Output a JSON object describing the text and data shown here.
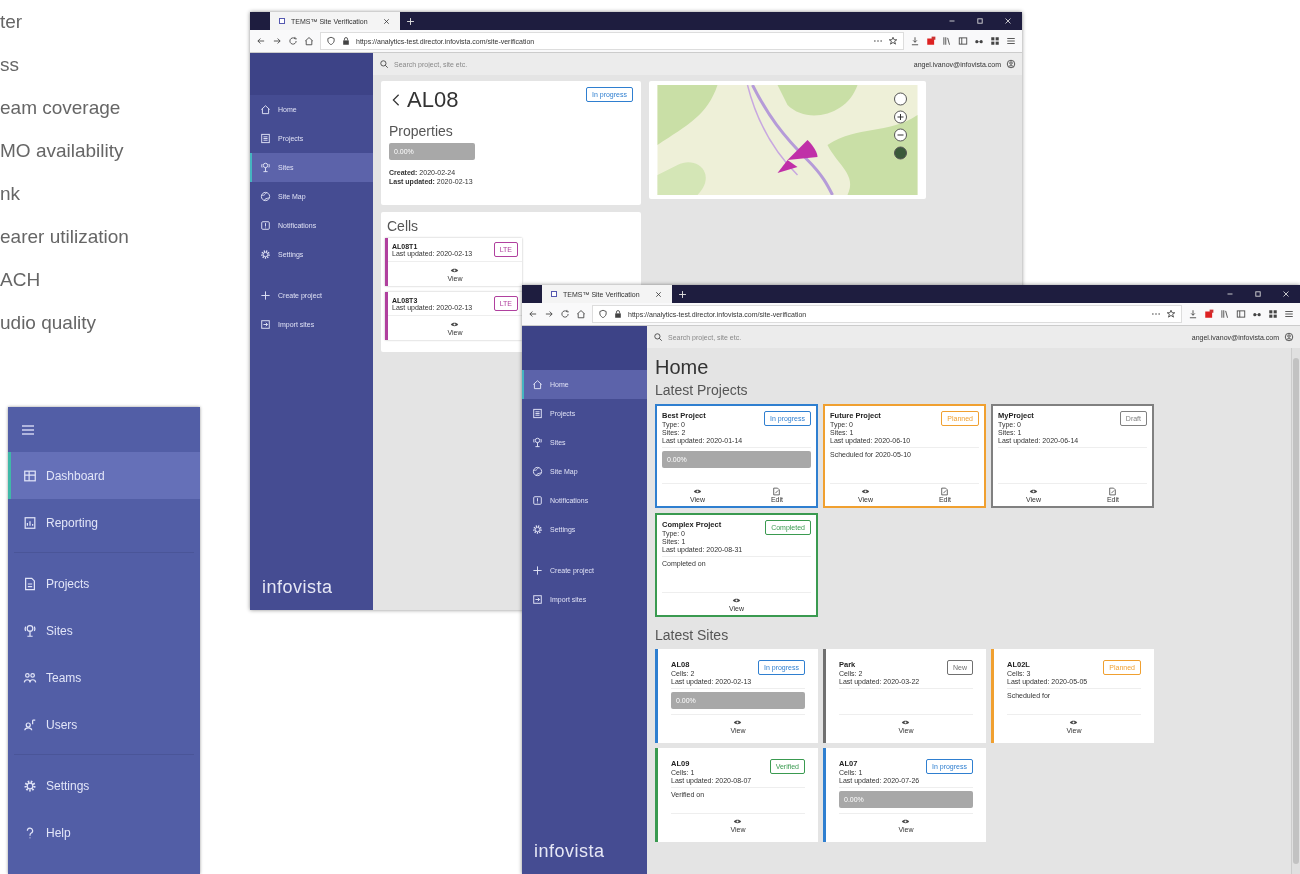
{
  "feature_list": [
    "ter",
    "ss",
    "eam coverage",
    "MO availability",
    "nk",
    "earer utilization",
    "ACH",
    "udio quality"
  ],
  "side_panel": {
    "groups": [
      [
        {
          "label": "Dashboard",
          "selected": true
        },
        {
          "label": "Reporting",
          "selected": false
        }
      ],
      [
        {
          "label": "Projects",
          "selected": false
        },
        {
          "label": "Sites",
          "selected": false
        },
        {
          "label": "Teams",
          "selected": false
        },
        {
          "label": "Users",
          "selected": false
        }
      ],
      [
        {
          "label": "Settings",
          "selected": false
        },
        {
          "label": "Help",
          "selected": false
        }
      ]
    ]
  },
  "back_window": {
    "tab_title": "TEMS™ Site Verification",
    "url": "https://analytics-test.director.infovista.com/site-verification",
    "search_placeholder": "Search project, site etc.",
    "user_email": "angel.ivanov@infovista.com",
    "nav": [
      {
        "label": "Home",
        "selected": false
      },
      {
        "label": "Projects",
        "selected": false
      },
      {
        "label": "Sites",
        "selected": true
      },
      {
        "label": "Site Map",
        "selected": false
      },
      {
        "label": "Notifications",
        "selected": false
      },
      {
        "label": "Settings",
        "selected": false
      }
    ],
    "actions": [
      "Create project",
      "Import sites"
    ],
    "logo": "infovista",
    "site": {
      "title": "AL08",
      "status": "In progress",
      "color": "#2f7fd0",
      "properties_heading": "Properties",
      "progress": {
        "level": 0,
        "label": "0.00%"
      },
      "dates": [
        "**Created:** 2020-02-24",
        "**Last updated:** 2020-02-13"
      ]
    },
    "cells": {
      "heading": "Cells",
      "items": [
        {
          "name": "AL08T1",
          "updated": "Last updated: 2020-02-13",
          "tech": "LTE",
          "color": "#b0409e",
          "action": "View"
        },
        {
          "name": "AL08T3",
          "updated": "Last updated: 2020-02-13",
          "tech": "LTE",
          "color": "#b0409e",
          "action": "View"
        }
      ]
    }
  },
  "front_window": {
    "tab_title": "TEMS™ Site Verification",
    "url": "https://analytics-test.director.infovista.com/site-verification",
    "search_placeholder": "Search project, site etc.",
    "user_email": "angel.ivanov@infovista.com",
    "nav": [
      {
        "label": "Home",
        "selected": true
      },
      {
        "label": "Projects",
        "selected": false
      },
      {
        "label": "Sites",
        "selected": false
      },
      {
        "label": "Site Map",
        "selected": false
      },
      {
        "label": "Notifications",
        "selected": false
      },
      {
        "label": "Settings",
        "selected": false
      }
    ],
    "actions": [
      "Create project",
      "Import sites"
    ],
    "logo": "infovista",
    "page_title": "Home",
    "projects_heading": "Latest Projects",
    "projects": [
      {
        "name": "Best Project",
        "meta": [
          "Type: 0",
          "Sites: 2",
          "Last updated: 2020-01-14"
        ],
        "status": "In progress",
        "color": "#2f7fd0",
        "progress": {
          "level": 0,
          "label": "0.00%"
        },
        "actions": [
          "View",
          "Edit"
        ]
      },
      {
        "name": "Future Project",
        "meta": [
          "Type: 0",
          "Sites: 1",
          "Last updated: 2020-06-10"
        ],
        "status": "Planned",
        "color": "#f0a030",
        "note": "Scheduled for 2020-05-10",
        "actions": [
          "View",
          "Edit"
        ]
      },
      {
        "name": "MyProject",
        "meta": [
          "Type: 0",
          "Sites: 1",
          "Last updated: 2020-06-14"
        ],
        "status": "Draft",
        "color": "#808080",
        "actions": [
          "View",
          "Edit"
        ]
      },
      {
        "name": "Complex Project",
        "meta": [
          "Type: 0",
          "Sites: 1",
          "Last updated: 2020-08-31"
        ],
        "status": "Completed",
        "color": "#3a9a50",
        "note": "Completed on",
        "actions": [
          "View"
        ]
      }
    ],
    "sites_heading": "Latest Sites",
    "sites": [
      {
        "name": "AL08",
        "meta": [
          "Cells: 2",
          "Last updated: 2020-02-13"
        ],
        "status": "In progress",
        "color": "#2f7fd0",
        "progress": {
          "level": 0,
          "label": "0.00%"
        },
        "actions": [
          "View"
        ]
      },
      {
        "name": "Park",
        "meta": [
          "Cells: 2",
          "Last updated: 2020-03-22"
        ],
        "status": "New",
        "color": "#707070",
        "actions": [
          "View"
        ]
      },
      {
        "name": "AL02L",
        "meta": [
          "Cells: 3",
          "Last updated: 2020-05-05"
        ],
        "status": "Planned",
        "color": "#f0a030",
        "note": "Scheduled for",
        "actions": [
          "View"
        ]
      },
      {
        "name": "AL09",
        "meta": [
          "Cells: 1",
          "Last updated: 2020-08-07"
        ],
        "status": "Verified",
        "color": "#3a9a50",
        "note": "Verified on",
        "actions": [
          "View"
        ]
      },
      {
        "name": "AL07",
        "meta": [
          "Cells: 1",
          "Last updated: 2020-07-26"
        ],
        "status": "In progress",
        "color": "#2f7fd0",
        "progress": {
          "level": 0,
          "label": "0.00%"
        },
        "actions": [
          "View"
        ]
      }
    ]
  }
}
